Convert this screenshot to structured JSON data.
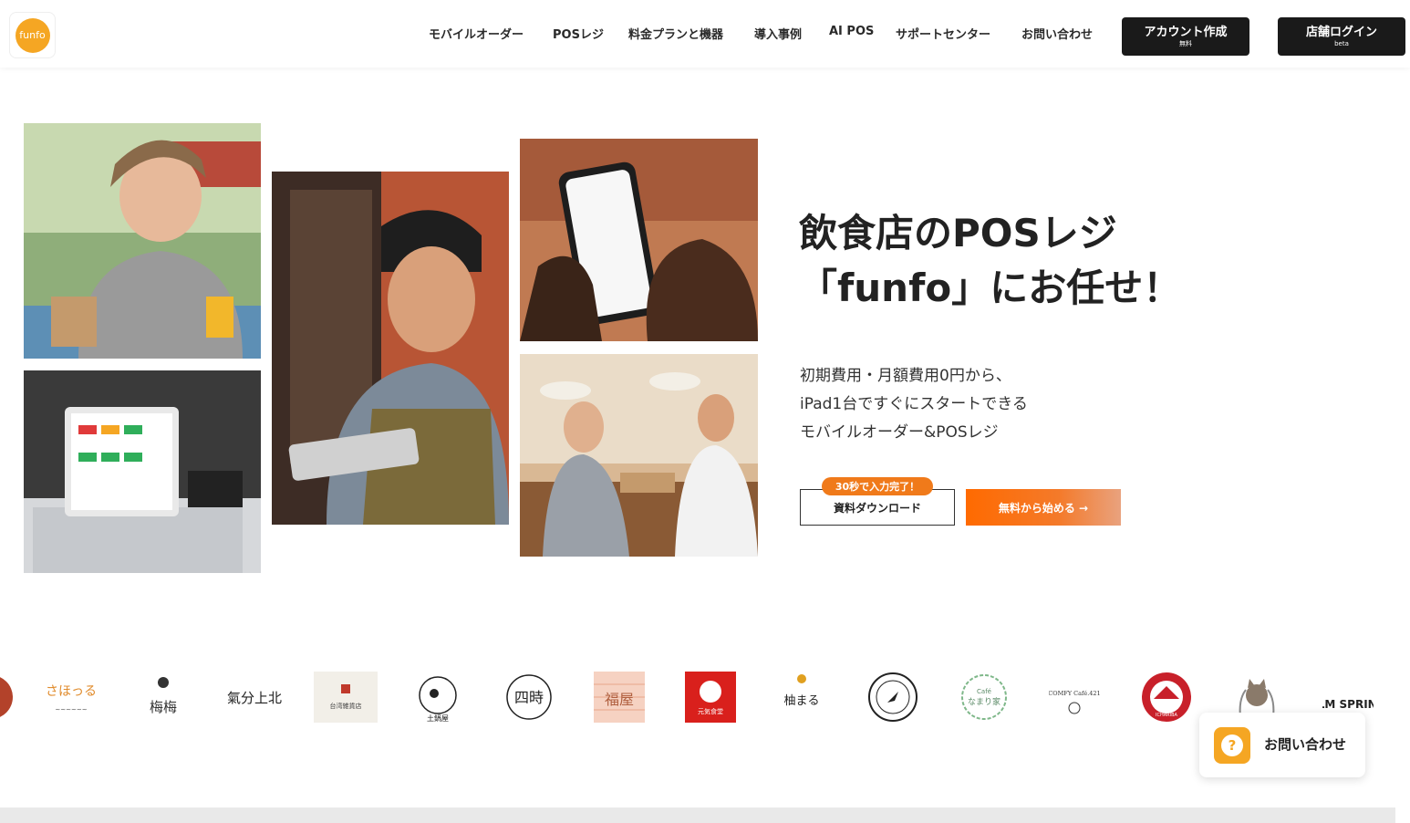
{
  "header": {
    "logo_text": "funfo",
    "nav": [
      {
        "label": "モバイルオーダー"
      },
      {
        "label": "POSレジ"
      },
      {
        "label": "料金プランと機器"
      },
      {
        "label": "導入事例"
      },
      {
        "label": "AI POS"
      },
      {
        "label": "サポートセンター"
      },
      {
        "label": "お問い合わせ"
      }
    ],
    "signup": {
      "label": "アカウント作成",
      "sub": "無料"
    },
    "login": {
      "label": "店舗ログイン",
      "sub": "beta"
    }
  },
  "hero": {
    "title_line1": "飲食店のPOSレジ",
    "title_line2": "「funfo」にお任せ！",
    "sub_line1": "初期費用・月額費用0円から、",
    "sub_line2": "iPad1台ですぐにスタートできる",
    "sub_line3": "モバイルオーダー&POSレジ",
    "badge": "30秒で入力完了！",
    "download_button": "資料ダウンロード",
    "start_button": "無料から始める →"
  },
  "client_logos": [
    {
      "text": "らさほっるる"
    },
    {
      "text": "梅梅"
    },
    {
      "text": "氣分上北"
    },
    {
      "text": "台湾雑貨店"
    },
    {
      "text": "土鍋屋"
    },
    {
      "text": "四時"
    },
    {
      "text": "福屋"
    },
    {
      "text": "元気食堂"
    },
    {
      "text": "柚まる"
    },
    {
      "text": "Café"
    },
    {
      "text": "なまり家"
    },
    {
      "text": "COMFY Café.421"
    },
    {
      "text": "ICHARIBA"
    },
    {
      "text": ""
    },
    {
      "text": "PALM SPRINGS"
    }
  ],
  "contact_widget": {
    "label": "お問い合わせ",
    "icon": "question-icon"
  },
  "colors": {
    "accent": "#ff6a00",
    "brand": "#f5a623",
    "dark": "#1a1a1a"
  }
}
